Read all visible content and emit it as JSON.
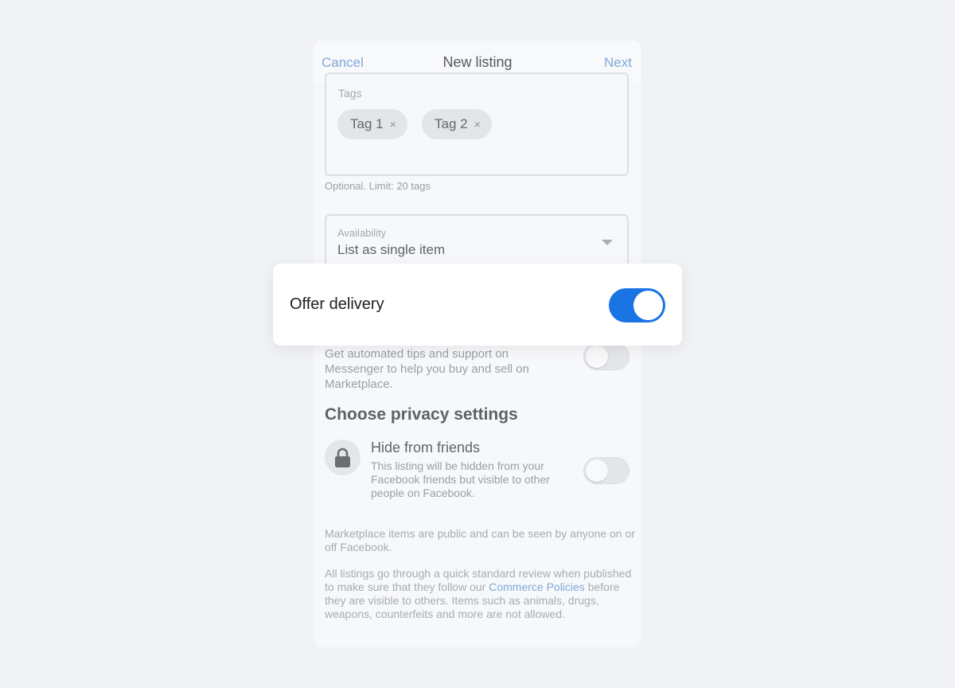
{
  "navbar": {
    "cancel_label": "Cancel",
    "title": "New listing",
    "next_label": "Next"
  },
  "tags": {
    "label": "Tags",
    "chips": [
      {
        "label": "Tag 1",
        "remove": "×"
      },
      {
        "label": "Tag 2",
        "remove": "×"
      }
    ],
    "helper": "Optional. Limit: 20 tags"
  },
  "availability": {
    "label": "Availability",
    "value": "List as single item"
  },
  "delivery": {
    "label": "Offer delivery",
    "enabled": true
  },
  "messenger_tips": {
    "text": "Get automated tips and support on Messenger to help you buy and sell on Marketplace.",
    "enabled": false
  },
  "privacy": {
    "heading": "Choose privacy settings",
    "hide_title": "Hide from friends",
    "hide_desc": "This listing will be hidden from your Facebook friends but visible to other people on Facebook.",
    "enabled": false,
    "icon": "lock-icon"
  },
  "notes": {
    "public": "Marketplace items are public and can be seen by anyone on or off Facebook.",
    "review_before": "All listings go through a quick standard review when published to make sure that they follow our ",
    "review_link": "Commerce Policies",
    "review_after": " before they are visible to others. Items such as animals, drugs, weapons, counterfeits and more are not allowed."
  },
  "colors": {
    "accent": "#1b74e4",
    "link": "#7fa8d9",
    "background": "#f0f2f5"
  }
}
